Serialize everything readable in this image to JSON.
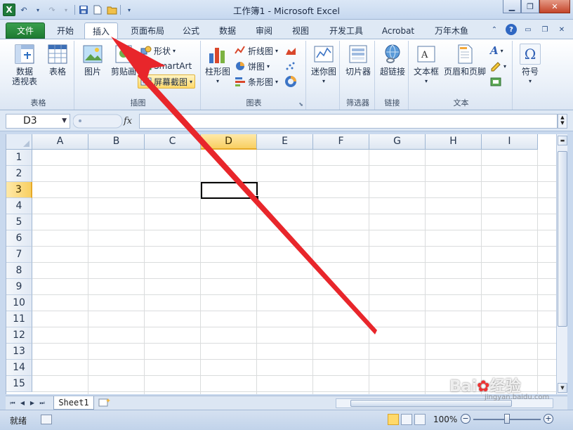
{
  "window": {
    "title": "工作簿1 - Microsoft Excel"
  },
  "qat": {
    "logo": "X",
    "undo_icon": "undo-icon",
    "redo_icon": "redo-icon",
    "save_icon": "save-icon",
    "new_icon": "new-file-icon",
    "open_icon": "open-folder-icon"
  },
  "ribbon": {
    "tabs": [
      {
        "label": "文件"
      },
      {
        "label": "开始"
      },
      {
        "label": "插入"
      },
      {
        "label": "页面布局"
      },
      {
        "label": "公式"
      },
      {
        "label": "数据"
      },
      {
        "label": "审阅"
      },
      {
        "label": "视图"
      },
      {
        "label": "开发工具"
      },
      {
        "label": "Acrobat"
      },
      {
        "label": "万年木鱼"
      }
    ],
    "active_tab": "插入",
    "groups": {
      "tables": {
        "label": "表格",
        "pivot_line1": "数据",
        "pivot_line2": "透视表",
        "table": "表格"
      },
      "illustrations": {
        "label": "插图",
        "picture": "图片",
        "clipart": "剪贴画",
        "shapes": "形状",
        "smartart": "SmartArt",
        "screenshot": "屏幕截图"
      },
      "charts": {
        "label": "图表",
        "column": "柱形图",
        "line": "折线图",
        "pie": "饼图",
        "bar": "条形图"
      },
      "sparklines": {
        "label": "迷你图",
        "name": "迷你图"
      },
      "filter": {
        "label": "筛选器",
        "slicer": "切片器"
      },
      "links": {
        "label": "链接",
        "hyperlink": "超链接"
      },
      "text": {
        "label": "文本",
        "textbox": "文本框",
        "header_footer": "页眉和页脚"
      },
      "symbols": {
        "symbol": "符号",
        "omega": "Ω"
      }
    }
  },
  "formula_bar": {
    "name_box": "D3",
    "fx": "fx",
    "content": ""
  },
  "grid": {
    "columns": [
      "A",
      "B",
      "C",
      "D",
      "E",
      "F",
      "G",
      "H",
      "I"
    ],
    "rows": [
      "1",
      "2",
      "3",
      "4",
      "5",
      "6",
      "7",
      "8",
      "9",
      "10",
      "11",
      "12",
      "13",
      "14",
      "15"
    ],
    "selected_column": "D",
    "selected_row": "3"
  },
  "sheets": {
    "tabs": [
      "Sheet1"
    ]
  },
  "status": {
    "mode": "就绪",
    "zoom": "100%"
  },
  "annotation": {
    "color": "#e8262b"
  }
}
